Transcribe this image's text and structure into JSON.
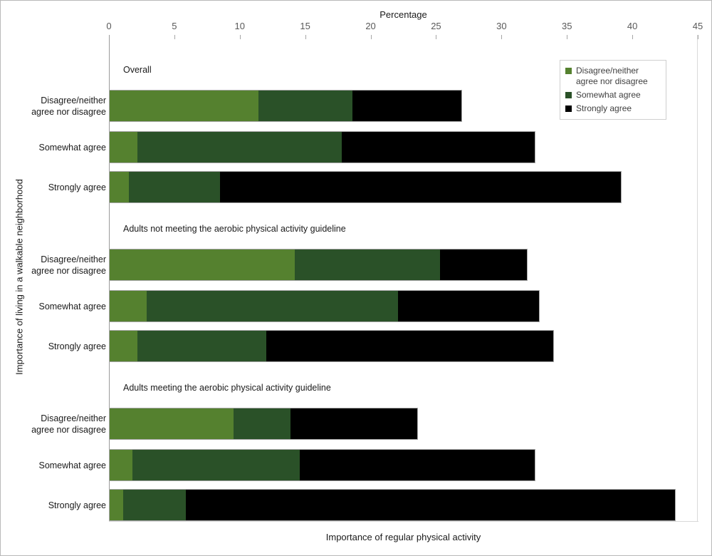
{
  "chart_data": {
    "type": "bar",
    "orientation": "horizontal",
    "stacked": true,
    "title": "",
    "xlabel": "Percentage",
    "xlabel_bottom": "Importance of regular physical activity",
    "ylabel": "Importance of living in a walkable neighborhood",
    "xlim": [
      0,
      45
    ],
    "xticks": [
      0,
      5,
      10,
      15,
      20,
      25,
      30,
      35,
      40,
      45
    ],
    "grid": false,
    "legend_position": "top-right",
    "legend": [
      {
        "name": "Disagree/neither agree nor disagree",
        "color": "#55812f"
      },
      {
        "name": "Somewhat agree",
        "color": "#2a5128"
      },
      {
        "name": "Strongly agree",
        "color": "#000000"
      }
    ],
    "categories": [
      "Disagree/neither\nagree nor disagree",
      "Somewhat agree",
      "Strongly agree"
    ],
    "panels": [
      {
        "title": "Overall",
        "rows": [
          {
            "category": "Disagree/neither agree nor disagree",
            "values": [
              11.4,
              7.2,
              8.4
            ],
            "total": 27.0
          },
          {
            "category": "Somewhat agree",
            "values": [
              2.2,
              15.6,
              14.8
            ],
            "total": 32.6
          },
          {
            "category": "Strongly agree",
            "values": [
              1.5,
              7.0,
              30.7
            ],
            "total": 39.2
          }
        ]
      },
      {
        "title": "Adults not meeting the aerobic physical activity guideline",
        "rows": [
          {
            "category": "Disagree/neither agree nor disagree",
            "values": [
              14.2,
              11.1,
              6.7
            ],
            "total": 32.0
          },
          {
            "category": "Somewhat agree",
            "values": [
              2.9,
              19.2,
              10.8
            ],
            "total": 32.9
          },
          {
            "category": "Strongly agree",
            "values": [
              2.2,
              9.8,
              22.0
            ],
            "total": 34.0
          }
        ]
      },
      {
        "title": "Adults meeting the aerobic physical activity guideline",
        "rows": [
          {
            "category": "Disagree/neither agree nor disagree",
            "values": [
              9.5,
              4.4,
              9.7
            ],
            "total": 23.6
          },
          {
            "category": "Somewhat agree",
            "values": [
              1.8,
              12.8,
              18.0
            ],
            "total": 32.6
          },
          {
            "category": "Strongly agree",
            "values": [
              1.1,
              4.8,
              37.4
            ],
            "total": 43.3
          }
        ]
      }
    ]
  }
}
